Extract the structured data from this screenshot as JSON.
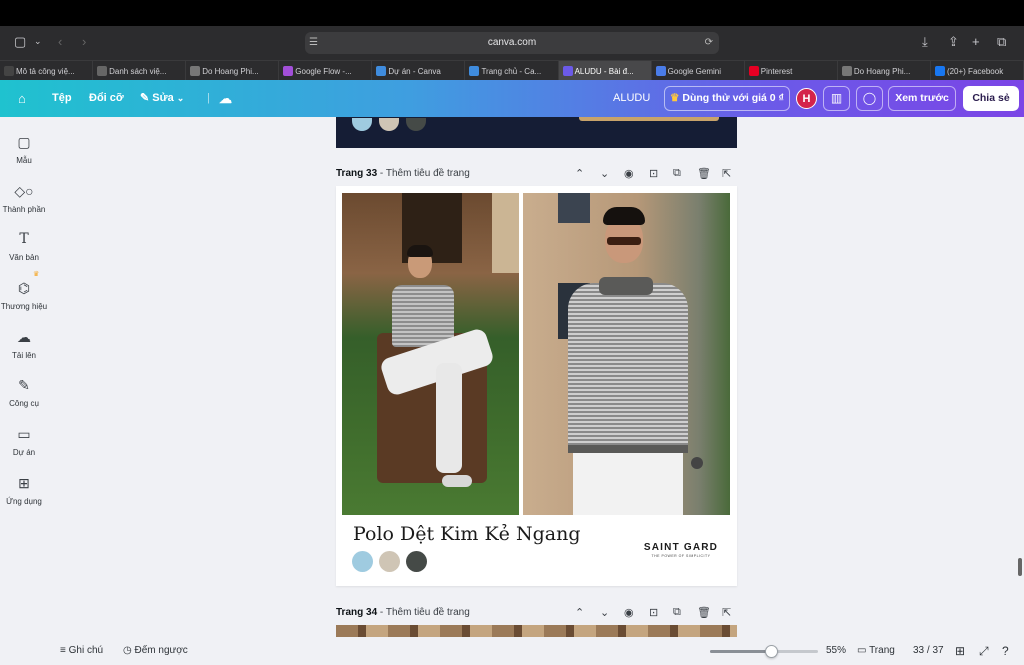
{
  "browser": {
    "url": "canva.com",
    "tabs": [
      {
        "label": "Mô tả công việ...",
        "icon": "chatgpt-icon",
        "color": "#444"
      },
      {
        "label": "Danh sách việ...",
        "icon": "j-icon",
        "color": "#666"
      },
      {
        "label": "Do Hoang Phi...",
        "icon": "h-icon",
        "color": "#777"
      },
      {
        "label": "Google Flow -...",
        "icon": "flow-icon",
        "color": "#a24fd8"
      },
      {
        "label": "Dự án - Canva",
        "icon": "canva-icon",
        "color": "#3f8cde"
      },
      {
        "label": "Trang chủ - Ca...",
        "icon": "canva-icon",
        "color": "#3f8cde"
      },
      {
        "label": "ALUDU - Bài đ...",
        "icon": "aludu-icon",
        "color": "#6b5ae8",
        "active": true
      },
      {
        "label": "Google Gemini",
        "icon": "gemini-icon",
        "color": "#4a7ce8"
      },
      {
        "label": "Pinterest",
        "icon": "pinterest-icon",
        "color": "#e60023"
      },
      {
        "label": "Do Hoang Phi...",
        "icon": "h-icon",
        "color": "#777"
      },
      {
        "label": "(20+) Facebook",
        "icon": "facebook-icon",
        "color": "#1877f2"
      }
    ]
  },
  "header": {
    "file": "Tệp",
    "resize": "Đổi cỡ",
    "edit": "Sửa",
    "project_name": "ALUDU",
    "trial": "Dùng thử với giá 0 ₫",
    "avatar": "H",
    "preview": "Xem trước",
    "share": "Chia sẻ"
  },
  "sidebar": {
    "items": [
      {
        "label": "Mẫu",
        "icon": "template-icon"
      },
      {
        "label": "Thành phần",
        "icon": "elements-icon"
      },
      {
        "label": "Văn bản",
        "icon": "text-icon"
      },
      {
        "label": "Thương hiệu",
        "icon": "brand-icon"
      },
      {
        "label": "Tải lên",
        "icon": "upload-icon"
      },
      {
        "label": "Công cụ",
        "icon": "tools-icon"
      },
      {
        "label": "Dự án",
        "icon": "folder-icon"
      },
      {
        "label": "Ứng dụng",
        "icon": "apps-icon"
      }
    ]
  },
  "pages": {
    "page33": {
      "number": "Trang 33",
      "add_title": " - Thêm tiêu đề trang",
      "product_title": "Polo Dệt Kim Kẻ Ngang",
      "brand_name": "SAINT GARD",
      "brand_tagline": "THE POWER OF SIMPLICITY",
      "swatches": [
        "#9fcbe0",
        "#cfc5b5",
        "#454a47"
      ]
    },
    "page34": {
      "number": "Trang 34",
      "add_title": " - Thêm tiêu đề trang"
    },
    "prev_swatches": [
      "#9fcbe0",
      "#cfc5b5",
      "#454a47"
    ]
  },
  "bottom": {
    "notes": "Ghi chú",
    "timer": "Đếm ngược",
    "zoom_percent": 55,
    "zoom": "55%",
    "pages_label": "Trang",
    "page_count": "33 / 37"
  }
}
